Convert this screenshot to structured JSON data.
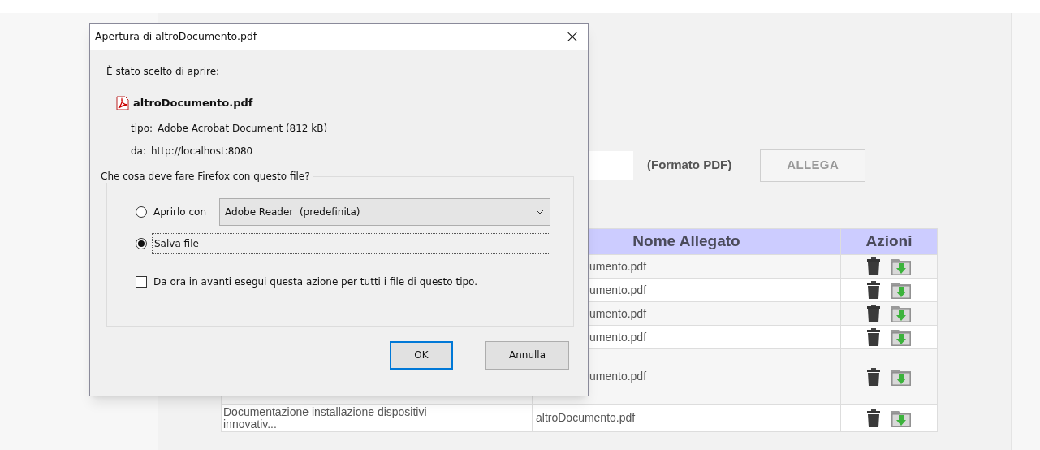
{
  "page": {
    "file_hint": "(Formato PDF)",
    "attach_button": "ALLEGA"
  },
  "table": {
    "columns": [
      "Nome Allegato",
      "Azioni"
    ],
    "rows": [
      {
        "kind": "single",
        "file": "umento.pdf"
      },
      {
        "kind": "single",
        "file": "umento.pdf"
      },
      {
        "kind": "single",
        "file": "umento.pdf"
      },
      {
        "kind": "single",
        "file": "umento.pdf"
      },
      {
        "kind": "wrapped",
        "file": "umento.pdf"
      },
      {
        "kind": "wrapped",
        "column_1": "Documentazione installazione dispositivi innovativ...",
        "file": "altroDocumento.pdf"
      }
    ]
  },
  "dialog": {
    "title": "Apertura di altroDocumento.pdf",
    "close": "×",
    "intro": "È stato scelto di aprire:",
    "file_name": "altroDocumento.pdf",
    "type_label": "tipo:",
    "type_value": "Adobe Acrobat Document (812 kB)",
    "from_label": "da:",
    "from_value": "http://localhost:8080",
    "group_label": "Che cosa deve fare Firefox con questo file?",
    "options": [
      {
        "kind": "radio",
        "label": "Aprirlo con",
        "selected": false,
        "app": "Adobe Reader  (predefinita)"
      },
      {
        "kind": "radio",
        "label": "Salva file",
        "selected": true
      }
    ],
    "remember": {
      "label": "Da ora in avanti esegui questa azione per tutti i file di questo tipo.",
      "checked": false
    },
    "buttons": [
      {
        "label": "OK",
        "default": true
      },
      {
        "label": "Annulla",
        "default": false
      }
    ]
  }
}
